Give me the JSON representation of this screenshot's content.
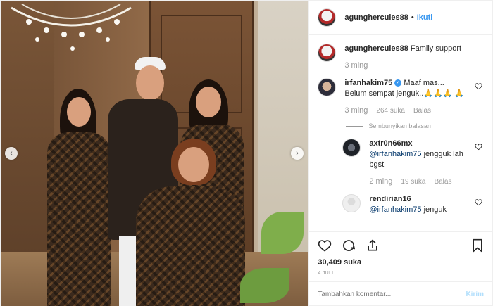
{
  "post": {
    "author": "agunghercules88",
    "follow_label": "Ikuti",
    "caption": "Family support",
    "caption_time": "3 ming",
    "likes": "30,409 suka",
    "date": "4 JULI"
  },
  "comments": [
    {
      "username": "irfanhakim75",
      "verified": true,
      "text": "Maaf mas... Belum sempat jenguk..🙏🙏🙏 🙏",
      "time": "3 ming",
      "likes": "264 suka",
      "reply_label": "Balas",
      "hide_replies_label": "Sembunyikan balasan"
    }
  ],
  "replies": [
    {
      "username": "axtr0n66mx",
      "mention": "@irfanhakim75",
      "text": " jengguk lah bgst",
      "time": "2 ming",
      "likes": "19 suka",
      "reply_label": "Balas"
    },
    {
      "username": "rendirian16",
      "mention": "@irfanhakim75",
      "text": " jenguk",
      "time": "",
      "likes": "",
      "reply_label": ""
    }
  ],
  "add_comment": {
    "placeholder": "Tambahkan komentar...",
    "send_label": "Kirim"
  },
  "icons": {
    "like": "heart-icon",
    "comment": "comment-icon",
    "share": "share-icon",
    "save": "bookmark-icon",
    "prev": "chevron-left-icon",
    "next": "chevron-right-icon"
  }
}
